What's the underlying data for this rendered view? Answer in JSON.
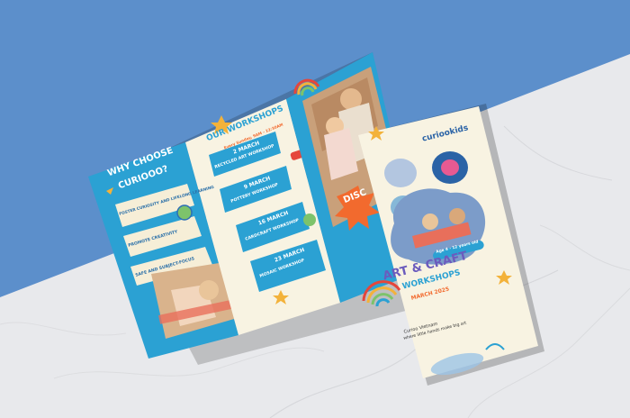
{
  "brochure": {
    "left_panel": {
      "heading_line1": "WHY CHOOSE",
      "heading_line2": "CURIOOO?",
      "points": [
        "FOSTER CURIOSITY AND LIFELONG LEARNING",
        "PROMOTE CREATIVITY",
        "SAFE AND SUBJECT-FOCUS"
      ]
    },
    "middle_panel": {
      "heading": "OUR WORKSHOPS",
      "subheading": "Every Sunday, 9AM - 12:30AM",
      "workshops": [
        {
          "date": "2 MARCH",
          "name": "RECYCLED ART WORKSHOP"
        },
        {
          "date": "9 MARCH",
          "name": "POTTERY WORKSHOP"
        },
        {
          "date": "16 MARCH",
          "name": "CARDCRAFT WORKSHOP"
        },
        {
          "date": "23 MARCH",
          "name": "MOSAIC WORKSHOP"
        }
      ]
    },
    "right_panel": {
      "badge_text": "DISC"
    },
    "cover": {
      "brand": "curiookids",
      "age_badge": "Age 4 - 12 years old",
      "title_line1": "ART & CRAFT",
      "title_line2": "WORKSHOPS",
      "date": "MARCH 2025",
      "venue": "Curioo Vietnam",
      "tagline": "where little hands make big art"
    }
  },
  "colors": {
    "backdrop_blue": "#5c8fcb",
    "marble": "#e9eaed",
    "brochure_teal": "#2ba1d3",
    "cream": "#f8f3e2",
    "accent_orange": "#f26a2e",
    "cover_purple": "#6b5bbd"
  }
}
